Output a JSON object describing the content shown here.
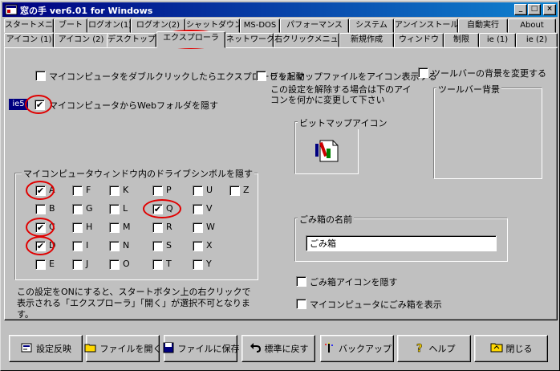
{
  "window": {
    "title": "窓の手 ver6.01 for Windows",
    "controls": {
      "minimize": "_",
      "maximize": "□",
      "close": "×"
    }
  },
  "tabs_row1": [
    "スタートメニュー",
    "ブート",
    "ログオン(1)",
    "ログオン(2)",
    "シャットダウン",
    "MS-DOS",
    "パフォーマンス",
    "システム",
    "アンインストール",
    "自動実行",
    "About"
  ],
  "tabs_row2": [
    "アイコン (1)",
    "アイコン (2)",
    "デスクトップ",
    "エクスプローラ",
    "ネットワーク",
    "右クリックメニュー",
    "新規作成",
    "ウィンドウ",
    "制限",
    "ie (1)",
    "ie (2)"
  ],
  "options": {
    "explorer_on_mycomputer": {
      "label": "マイコンピュータをダブルクリックしたらエクスプローラを起動",
      "checked": false
    },
    "bitmap_icon": {
      "label": "ビットマップファイルをアイコン表示する",
      "checked": false
    },
    "toolbar_bg": {
      "label": "ツールバーの背景を変更する",
      "checked": false
    },
    "hide_webfolder": {
      "label": "マイコンピュータからWebフォルダを隠す",
      "checked": true,
      "badge": "ie5"
    },
    "bitmap_note": "この設定を解除する場合は下のアイコンを何かに変更して下さい",
    "bitmap_icon_group": "ビットマップアイコン",
    "toolbar_bg_group": "ツールバー背景",
    "hide_recycle_icon": {
      "label": "ごみ箱アイコンを隠す",
      "checked": false
    },
    "recycle_on_mycomputer": {
      "label": "マイコンピュータにごみ箱を表示",
      "checked": false
    }
  },
  "drives": {
    "title": "マイコンピュータウィンドウ内のドライブシンボルを隠す",
    "columns": [
      [
        {
          "l": "A",
          "c": true
        },
        {
          "l": "B",
          "c": false
        },
        {
          "l": "C",
          "c": true
        },
        {
          "l": "D",
          "c": true
        },
        {
          "l": "E",
          "c": false
        }
      ],
      [
        {
          "l": "F",
          "c": false
        },
        {
          "l": "G",
          "c": false
        },
        {
          "l": "H",
          "c": false
        },
        {
          "l": "I",
          "c": false
        },
        {
          "l": "J",
          "c": false
        }
      ],
      [
        {
          "l": "K",
          "c": false
        },
        {
          "l": "L",
          "c": false
        },
        {
          "l": "M",
          "c": false
        },
        {
          "l": "N",
          "c": false
        },
        {
          "l": "O",
          "c": false
        }
      ],
      [
        {
          "l": "P",
          "c": false
        },
        {
          "l": "Q",
          "c": true
        },
        {
          "l": "R",
          "c": false
        },
        {
          "l": "S",
          "c": false
        },
        {
          "l": "T",
          "c": false
        }
      ],
      [
        {
          "l": "U",
          "c": false
        },
        {
          "l": "V",
          "c": false
        },
        {
          "l": "W",
          "c": false
        },
        {
          "l": "X",
          "c": false
        },
        {
          "l": "Y",
          "c": false
        }
      ],
      [
        {
          "l": "Z",
          "c": false
        }
      ]
    ],
    "note": "この設定をONにすると、スタートボタン上の右クリックで表示される「エクスプローラ」「開く」が選択不可となります。"
  },
  "recycle": {
    "group_title": "ごみ箱の名前",
    "name_value": "ごみ箱"
  },
  "buttons": [
    {
      "label": "設定反映",
      "icon": "apply-settings-icon"
    },
    {
      "label": "ファイルを開く",
      "icon": "open-folder-icon"
    },
    {
      "label": "ファイルに保存",
      "icon": "save-disk-icon"
    },
    {
      "label": "標準に戻す",
      "icon": "undo-arrow-icon"
    },
    {
      "label": "バックアップ",
      "icon": "backup-magic-icon"
    },
    {
      "label": "ヘルプ",
      "icon": "help-question-icon"
    },
    {
      "label": "閉じる",
      "icon": "close-folder-icon"
    }
  ],
  "colors": {
    "title_bar": "#000080",
    "face": "#c0c0c0",
    "highlight_oval": "#e00000"
  }
}
